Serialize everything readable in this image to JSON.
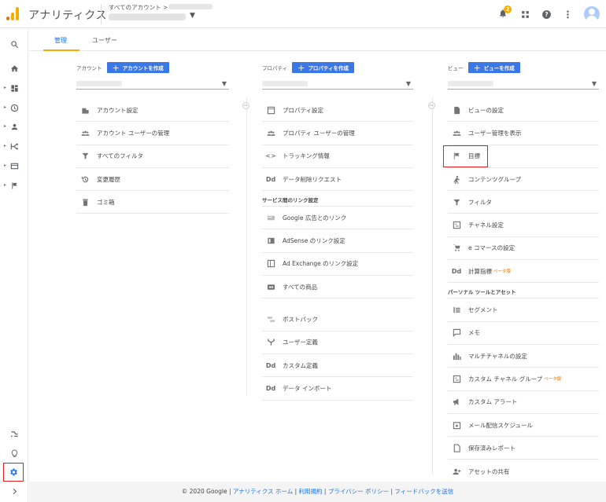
{
  "header": {
    "app_title": "アナリティクス",
    "account_path": "すべてのアカウント >",
    "notification_count": "2"
  },
  "tabs": [
    "管理",
    "ユーザー"
  ],
  "account": {
    "title": "アカウント",
    "create_label": "アカウントを作成",
    "items": [
      "アカウント設定",
      "アカウント ユーザーの管理",
      "すべてのフィルタ",
      "変更履歴",
      "ゴミ箱"
    ]
  },
  "property": {
    "title": "プロパティ",
    "create_label": "プロパティを作成",
    "items": [
      "プロパティ設定",
      "プロパティ ユーザーの管理",
      "トラッキング情報",
      "データ削除リクエスト"
    ],
    "section_title": "サービス間のリンク設定",
    "links": [
      "Google 広告とのリンク",
      "AdSense のリンク設定",
      "Ad Exchange のリンク設定",
      "すべての商品"
    ],
    "extra": [
      "ポストバック",
      "ユーザー定義",
      "カスタム定義",
      "データ インポート"
    ]
  },
  "view": {
    "title": "ビュー",
    "create_label": "ビューを作成",
    "items": [
      "ビューの設定",
      "ユーザー管理を表示",
      "目標",
      "コンテンツグループ",
      "フィルタ",
      "チャネル設定",
      "e コマースの設定",
      "計算指標"
    ],
    "beta_label": "ベータ版",
    "section_title": "パーソナル ツールとアセット",
    "personal": [
      "セグメント",
      "メモ",
      "マルチチャネルの設定",
      "カスタム チャネル グループ",
      "カスタム アラート",
      "メール配信スケジュール",
      "保存済みレポート",
      "アセットの共有"
    ]
  },
  "footer": {
    "copyright": "© 2020 Google |",
    "links": [
      "アナリティクス ホーム",
      "利用規約",
      "プライバシー ポリシー",
      "フィードバックを送信"
    ]
  },
  "colors": {
    "accent": "#1a73e8",
    "brand": "#f9ab00",
    "highlight": "#e02020"
  }
}
